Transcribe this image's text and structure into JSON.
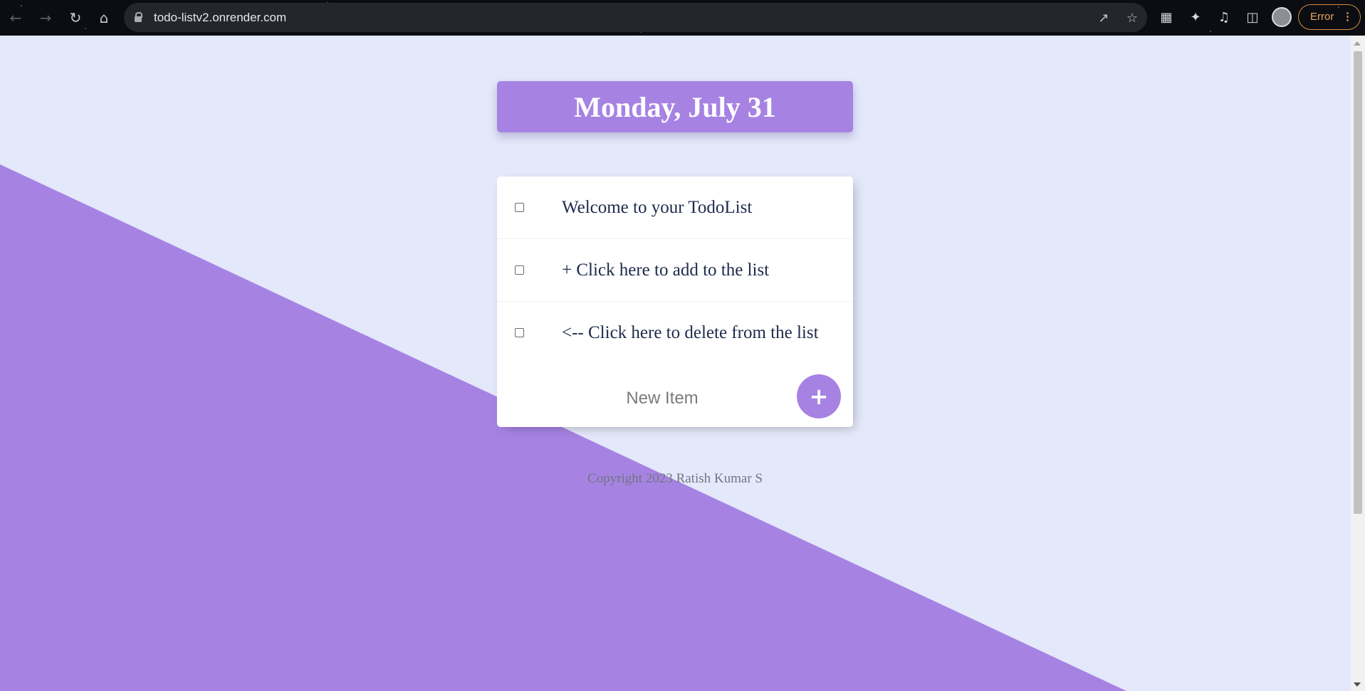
{
  "browser": {
    "url": "todo-listv2.onrender.com",
    "status_label": "Error",
    "icons": [
      "back-arrow",
      "forward-arrow",
      "reload",
      "home",
      "lock",
      "share",
      "star",
      "extension-s",
      "puzzle",
      "media-queue",
      "side-panel",
      "avatar",
      "menu-dots"
    ]
  },
  "page": {
    "day_title": "Monday, July 31",
    "items": [
      {
        "label": "Welcome to your TodoList"
      },
      {
        "label": "+ Click here to add to the list"
      },
      {
        "label": "<-- Click here to delete from the list"
      }
    ],
    "new_item_placeholder": "New Item",
    "add_button_label": "+",
    "footer": "Copyright 2023 Ratish Kumar S"
  },
  "colors": {
    "accent": "#a683e3",
    "background": "#e3e8fa",
    "card": "#ffffff",
    "text": "#1f2a4a"
  }
}
